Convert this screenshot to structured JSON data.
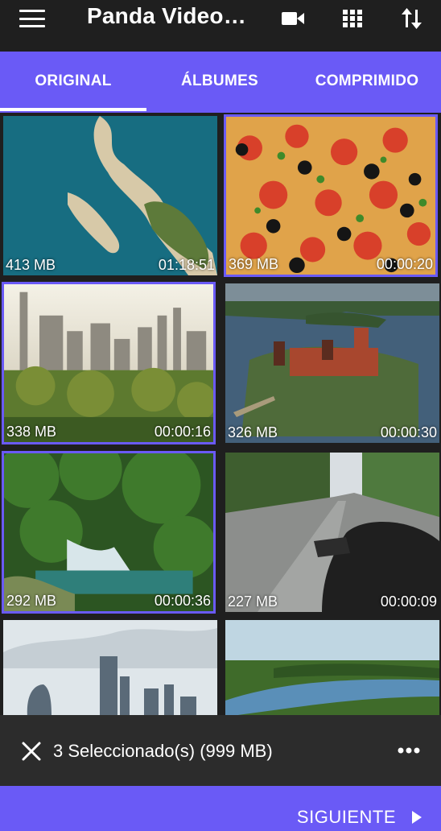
{
  "app": {
    "title": "Panda Video…"
  },
  "toolbar": {
    "icons": [
      "menu-icon",
      "video-camera-icon",
      "grid-view-icon",
      "sort-icon"
    ]
  },
  "tabs": [
    {
      "label": "ORIGINAL",
      "active": true
    },
    {
      "label": "ÁLBUMES",
      "active": false
    },
    {
      "label": "COMPRIMIDO",
      "active": false
    }
  ],
  "videos": [
    {
      "size": "413 MB",
      "duration": "01:18:51",
      "selected": false,
      "thumb": "aerial-island-coast"
    },
    {
      "size": "369 MB",
      "duration": "00:00:20",
      "selected": true,
      "thumb": "pizza-closeup"
    },
    {
      "size": "338 MB",
      "duration": "00:00:16",
      "selected": true,
      "thumb": "city-skyline-park"
    },
    {
      "size": "326 MB",
      "duration": "00:00:30",
      "selected": false,
      "thumb": "lake-castle-aerial"
    },
    {
      "size": "292 MB",
      "duration": "00:00:36",
      "selected": true,
      "thumb": "jungle-waterfall"
    },
    {
      "size": "227 MB",
      "duration": "00:00:09",
      "selected": false,
      "thumb": "motorcycle-road"
    },
    {
      "size": "",
      "duration": "",
      "selected": false,
      "thumb": "london-skyline"
    },
    {
      "size": "",
      "duration": "",
      "selected": false,
      "thumb": "river-forest-aerial"
    }
  ],
  "selection": {
    "text": "3 Seleccionado(s) (999 MB)"
  },
  "footer": {
    "next_label": "SIGUIENTE"
  },
  "colors": {
    "accent": "#6a5af6",
    "background": "#1f1f1f",
    "selection_bar": "#2c2c2c"
  }
}
